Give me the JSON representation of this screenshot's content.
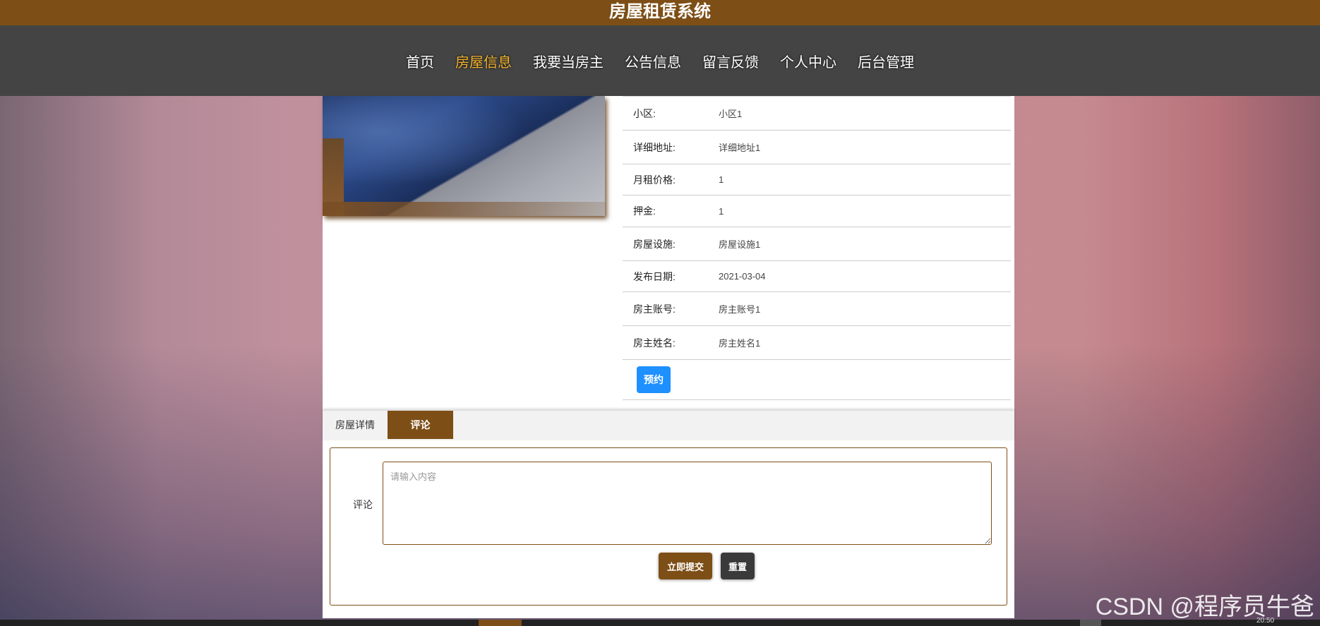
{
  "site_title": "房屋租赁系统",
  "nav": [
    {
      "label": "首页",
      "active": false
    },
    {
      "label": "房屋信息",
      "active": true
    },
    {
      "label": "我要当房主",
      "active": false
    },
    {
      "label": "公告信息",
      "active": false
    },
    {
      "label": "留言反馈",
      "active": false
    },
    {
      "label": "个人中心",
      "active": false
    },
    {
      "label": "后台管理",
      "active": false
    }
  ],
  "details": [
    {
      "label": "小区:",
      "value": "小区1"
    },
    {
      "label": "详细地址:",
      "value": "详细地址1"
    },
    {
      "label": "月租价格:",
      "value": "1"
    },
    {
      "label": "押金:",
      "value": "1"
    },
    {
      "label": "房屋设施:",
      "value": "房屋设施1"
    },
    {
      "label": "发布日期:",
      "value": "2021-03-04"
    },
    {
      "label": "房主账号:",
      "value": "房主账号1"
    },
    {
      "label": "房主姓名:",
      "value": "房主姓名1"
    }
  ],
  "reserve_button": "预约",
  "tabs": [
    {
      "label": "房屋详情",
      "active": false
    },
    {
      "label": "评论",
      "active": true
    }
  ],
  "comment": {
    "label": "评论",
    "placeholder": "请输入内容",
    "value": "",
    "submit_label": "立即提交",
    "reset_label": "重置"
  },
  "taskbar_time": "20:50",
  "watermark": "CSDN @程序员牛爸",
  "colors": {
    "brand": "#7d4e16",
    "nav_bg": "#444444",
    "active_nav": "#f0b22e",
    "reserve_button": "#1e90ff"
  }
}
